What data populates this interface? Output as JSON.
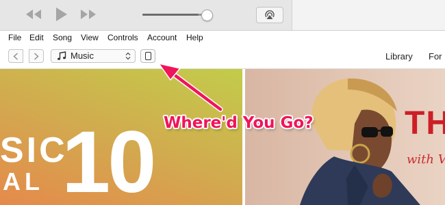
{
  "player": {
    "controls": {
      "rewind": "rewind-icon",
      "play": "play-icon",
      "fast_forward": "fast-forward-icon",
      "airplay": "airplay-icon"
    },
    "volume": 0.85
  },
  "menubar": {
    "items": [
      "File",
      "Edit",
      "Song",
      "View",
      "Controls",
      "Account",
      "Help"
    ]
  },
  "navbar": {
    "media_selector": "Music",
    "tabs": [
      "Library",
      "For"
    ]
  },
  "content": {
    "left_banner": {
      "line1": "SIC",
      "line2": "AL",
      "number": "10"
    },
    "right_banner": {
      "headline": "TH",
      "subline": "with V"
    }
  },
  "annotation": {
    "text": "Where'd You Go?",
    "color": "#f0145a"
  },
  "colors": {
    "accent_pink": "#f0145a",
    "banner_red": "#cc1f27"
  }
}
